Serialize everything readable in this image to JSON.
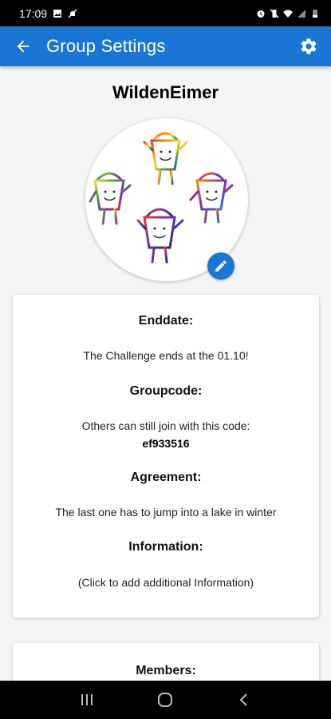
{
  "status_bar": {
    "time": "17:09",
    "left_icons": [
      "image-icon",
      "mute-notifications-icon"
    ],
    "right_icons": [
      "alarm-icon",
      "vibrate-off-icon",
      "wifi-icon",
      "signal-icon",
      "battery-icon"
    ]
  },
  "app_bar": {
    "title": "Group Settings",
    "back_icon": "arrow-back-icon",
    "settings_icon": "gear-icon",
    "color": "#1976d2"
  },
  "group": {
    "name": "WildenEimer",
    "avatar": "bucket-characters-image",
    "edit_icon": "pencil-icon"
  },
  "info": {
    "enddate": {
      "title": "Enddate:",
      "text": "The Challenge ends at the 01.10!"
    },
    "groupcode": {
      "title": "Groupcode:",
      "text": "Others can still join with this code:",
      "code": "ef933516"
    },
    "agreement": {
      "title": "Agreement:",
      "text": "The last one has to jump into a lake in winter"
    },
    "information": {
      "title": "Information:",
      "text": "(Click to add additional Information)"
    }
  },
  "members": {
    "title": "Members:"
  },
  "nav_bar": {
    "icons": [
      "recent-apps-icon",
      "home-icon",
      "back-icon"
    ]
  }
}
